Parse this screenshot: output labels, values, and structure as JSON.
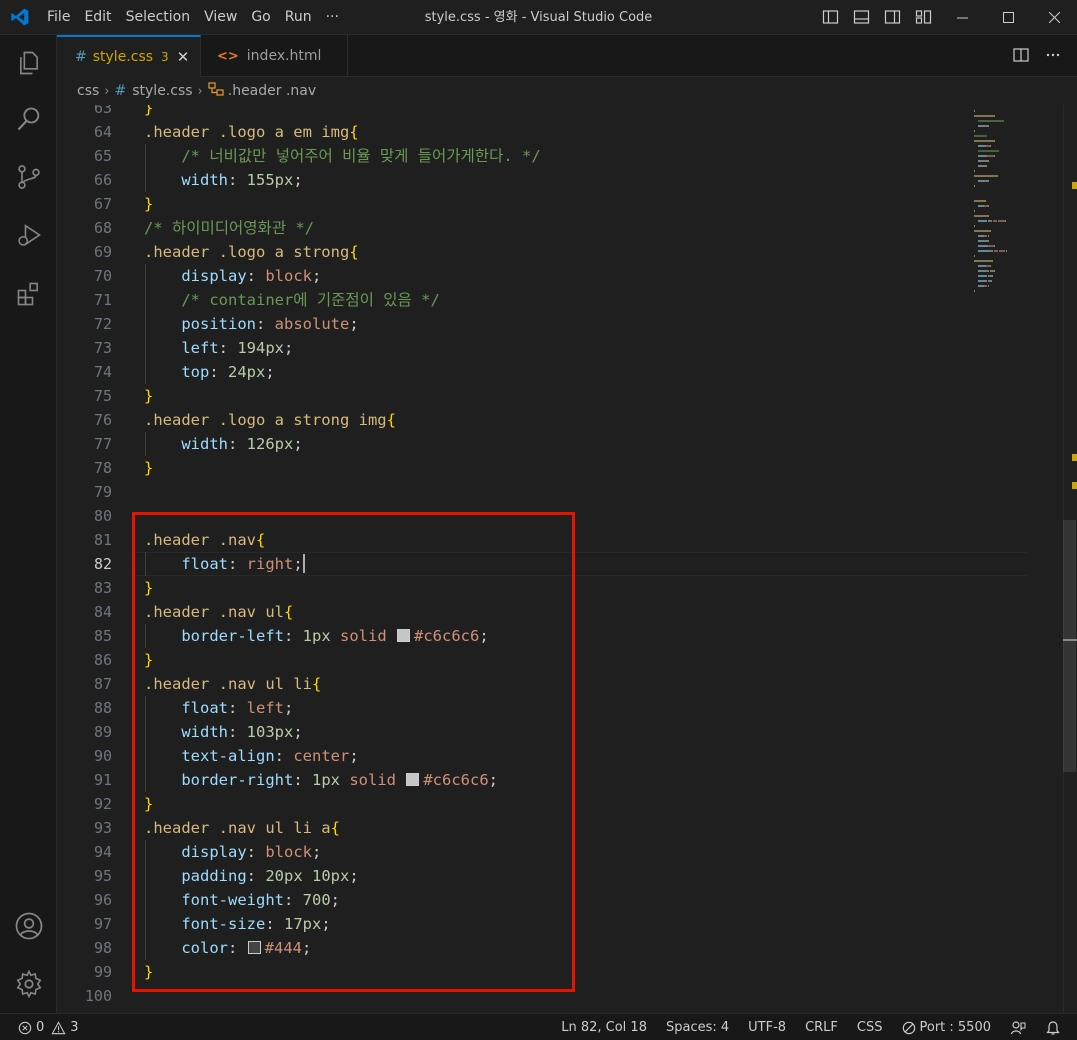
{
  "window": {
    "title": "style.css - 영화 - Visual Studio Code",
    "menu": [
      "File",
      "Edit",
      "Selection",
      "View",
      "Go",
      "Run",
      "···"
    ]
  },
  "tabs": [
    {
      "icon": "#",
      "label": "style.css",
      "badge": "3",
      "close": "✕"
    },
    {
      "icon": "<>",
      "label": "index.html"
    }
  ],
  "breadcrumb": {
    "folder": "css",
    "file_icon": "#",
    "file": "style.css",
    "symbol": ".header .nav"
  },
  "editor": {
    "current_line": 82,
    "lines": [
      {
        "n": "63",
        "tokens": [
          {
            "t": "}",
            "c": "brace"
          }
        ]
      },
      {
        "n": "64",
        "tokens": [
          {
            "t": ".header .logo a em img",
            "c": "sel"
          },
          {
            "t": "{",
            "c": "brace"
          }
        ]
      },
      {
        "n": "65",
        "tokens": [
          {
            "t": "    "
          },
          {
            "t": "/* 너비값만 넣어주어 비율 맞게 들어가게한다. */",
            "c": "comment"
          }
        ]
      },
      {
        "n": "66",
        "tokens": [
          {
            "t": "    "
          },
          {
            "t": "width",
            "c": "prop"
          },
          {
            "t": ": ",
            "c": "punc"
          },
          {
            "t": "155px",
            "c": "num"
          },
          {
            "t": ";",
            "c": "punc"
          }
        ]
      },
      {
        "n": "67",
        "tokens": [
          {
            "t": "}",
            "c": "brace"
          }
        ]
      },
      {
        "n": "68",
        "tokens": [
          {
            "t": "/* 하이미디어영화관 */",
            "c": "comment"
          }
        ]
      },
      {
        "n": "69",
        "tokens": [
          {
            "t": ".header .logo a strong",
            "c": "sel"
          },
          {
            "t": "{",
            "c": "brace"
          }
        ]
      },
      {
        "n": "70",
        "tokens": [
          {
            "t": "    "
          },
          {
            "t": "display",
            "c": "prop"
          },
          {
            "t": ": ",
            "c": "punc"
          },
          {
            "t": "block",
            "c": "val"
          },
          {
            "t": ";",
            "c": "punc"
          }
        ]
      },
      {
        "n": "71",
        "tokens": [
          {
            "t": "    "
          },
          {
            "t": "/* container에 기준점이 있음 */",
            "c": "comment"
          }
        ]
      },
      {
        "n": "72",
        "tokens": [
          {
            "t": "    "
          },
          {
            "t": "position",
            "c": "prop"
          },
          {
            "t": ": ",
            "c": "punc"
          },
          {
            "t": "absolute",
            "c": "val"
          },
          {
            "t": ";",
            "c": "punc"
          }
        ]
      },
      {
        "n": "73",
        "tokens": [
          {
            "t": "    "
          },
          {
            "t": "left",
            "c": "prop"
          },
          {
            "t": ": ",
            "c": "punc"
          },
          {
            "t": "194px",
            "c": "num"
          },
          {
            "t": ";",
            "c": "punc"
          }
        ]
      },
      {
        "n": "74",
        "tokens": [
          {
            "t": "    "
          },
          {
            "t": "top",
            "c": "prop"
          },
          {
            "t": ": ",
            "c": "punc"
          },
          {
            "t": "24px",
            "c": "num"
          },
          {
            "t": ";",
            "c": "punc"
          }
        ]
      },
      {
        "n": "75",
        "tokens": [
          {
            "t": "}",
            "c": "brace"
          }
        ]
      },
      {
        "n": "76",
        "tokens": [
          {
            "t": ".header .logo a strong img",
            "c": "sel"
          },
          {
            "t": "{",
            "c": "brace"
          }
        ]
      },
      {
        "n": "77",
        "tokens": [
          {
            "t": "    "
          },
          {
            "t": "width",
            "c": "prop"
          },
          {
            "t": ": ",
            "c": "punc"
          },
          {
            "t": "126px",
            "c": "num"
          },
          {
            "t": ";",
            "c": "punc"
          }
        ]
      },
      {
        "n": "78",
        "tokens": [
          {
            "t": "}",
            "c": "brace"
          }
        ]
      },
      {
        "n": "79",
        "tokens": []
      },
      {
        "n": "80",
        "tokens": []
      },
      {
        "n": "81",
        "tokens": [
          {
            "t": ".header .nav",
            "c": "sel"
          },
          {
            "t": "{",
            "c": "brace"
          }
        ]
      },
      {
        "n": "82",
        "tokens": [
          {
            "t": "    "
          },
          {
            "t": "float",
            "c": "prop"
          },
          {
            "t": ": ",
            "c": "punc"
          },
          {
            "t": "right",
            "c": "val"
          },
          {
            "t": ";",
            "c": "punc"
          },
          {
            "cursor": true
          }
        ]
      },
      {
        "n": "83",
        "tokens": [
          {
            "t": "}",
            "c": "brace"
          }
        ]
      },
      {
        "n": "84",
        "tokens": [
          {
            "t": ".header .nav ul",
            "c": "sel"
          },
          {
            "t": "{",
            "c": "brace"
          }
        ]
      },
      {
        "n": "85",
        "tokens": [
          {
            "t": "    "
          },
          {
            "t": "border-left",
            "c": "prop"
          },
          {
            "t": ": ",
            "c": "punc"
          },
          {
            "t": "1px",
            "c": "num"
          },
          {
            "t": " "
          },
          {
            "t": "solid",
            "c": "val"
          },
          {
            "t": " "
          },
          {
            "swatch": "#c6c6c6"
          },
          {
            "t": "#c6c6c6",
            "c": "val"
          },
          {
            "t": ";",
            "c": "punc"
          }
        ]
      },
      {
        "n": "86",
        "tokens": [
          {
            "t": "}",
            "c": "brace"
          }
        ]
      },
      {
        "n": "87",
        "tokens": [
          {
            "t": ".header .nav ul li",
            "c": "sel"
          },
          {
            "t": "{",
            "c": "brace"
          }
        ]
      },
      {
        "n": "88",
        "tokens": [
          {
            "t": "    "
          },
          {
            "t": "float",
            "c": "prop"
          },
          {
            "t": ": ",
            "c": "punc"
          },
          {
            "t": "left",
            "c": "val"
          },
          {
            "t": ";",
            "c": "punc"
          }
        ]
      },
      {
        "n": "89",
        "tokens": [
          {
            "t": "    "
          },
          {
            "t": "width",
            "c": "prop"
          },
          {
            "t": ": ",
            "c": "punc"
          },
          {
            "t": "103px",
            "c": "num"
          },
          {
            "t": ";",
            "c": "punc"
          }
        ]
      },
      {
        "n": "90",
        "tokens": [
          {
            "t": "    "
          },
          {
            "t": "text-align",
            "c": "prop"
          },
          {
            "t": ": ",
            "c": "punc"
          },
          {
            "t": "center",
            "c": "val"
          },
          {
            "t": ";",
            "c": "punc"
          }
        ]
      },
      {
        "n": "91",
        "tokens": [
          {
            "t": "    "
          },
          {
            "t": "border-right",
            "c": "prop"
          },
          {
            "t": ": ",
            "c": "punc"
          },
          {
            "t": "1px",
            "c": "num"
          },
          {
            "t": " "
          },
          {
            "t": "solid",
            "c": "val"
          },
          {
            "t": " "
          },
          {
            "swatch": "#c6c6c6"
          },
          {
            "t": "#c6c6c6",
            "c": "val"
          },
          {
            "t": ";",
            "c": "punc"
          }
        ]
      },
      {
        "n": "92",
        "tokens": [
          {
            "t": "}",
            "c": "brace"
          }
        ]
      },
      {
        "n": "93",
        "tokens": [
          {
            "t": ".header .nav ul li a",
            "c": "sel"
          },
          {
            "t": "{",
            "c": "brace"
          }
        ]
      },
      {
        "n": "94",
        "tokens": [
          {
            "t": "    "
          },
          {
            "t": "display",
            "c": "prop"
          },
          {
            "t": ": ",
            "c": "punc"
          },
          {
            "t": "block",
            "c": "val"
          },
          {
            "t": ";",
            "c": "punc"
          }
        ]
      },
      {
        "n": "95",
        "tokens": [
          {
            "t": "    "
          },
          {
            "t": "padding",
            "c": "prop"
          },
          {
            "t": ": ",
            "c": "punc"
          },
          {
            "t": "20px",
            "c": "num"
          },
          {
            "t": " "
          },
          {
            "t": "10px",
            "c": "num"
          },
          {
            "t": ";",
            "c": "punc"
          }
        ]
      },
      {
        "n": "96",
        "tokens": [
          {
            "t": "    "
          },
          {
            "t": "font-weight",
            "c": "prop"
          },
          {
            "t": ": ",
            "c": "punc"
          },
          {
            "t": "700",
            "c": "num"
          },
          {
            "t": ";",
            "c": "punc"
          }
        ]
      },
      {
        "n": "97",
        "tokens": [
          {
            "t": "    "
          },
          {
            "t": "font-size",
            "c": "prop"
          },
          {
            "t": ": ",
            "c": "punc"
          },
          {
            "t": "17px",
            "c": "num"
          },
          {
            "t": ";",
            "c": "punc"
          }
        ]
      },
      {
        "n": "98",
        "tokens": [
          {
            "t": "    "
          },
          {
            "t": "color",
            "c": "prop"
          },
          {
            "t": ": ",
            "c": "punc"
          },
          {
            "swatch": "#444444"
          },
          {
            "t": "#444",
            "c": "val"
          },
          {
            "t": ";",
            "c": "punc"
          }
        ]
      },
      {
        "n": "99",
        "tokens": [
          {
            "t": "}",
            "c": "brace"
          }
        ]
      },
      {
        "n": "100",
        "tokens": []
      }
    ]
  },
  "statusbar": {
    "errors": "0",
    "warnings": "3",
    "position": "Ln 82, Col 18",
    "spaces": "Spaces: 4",
    "encoding": "UTF-8",
    "eol": "CRLF",
    "language": "CSS",
    "port": "Port : 5500"
  },
  "colors": {
    "accent": "#0078d4",
    "highlight_box": "#e51400",
    "warning": "#cca700"
  }
}
